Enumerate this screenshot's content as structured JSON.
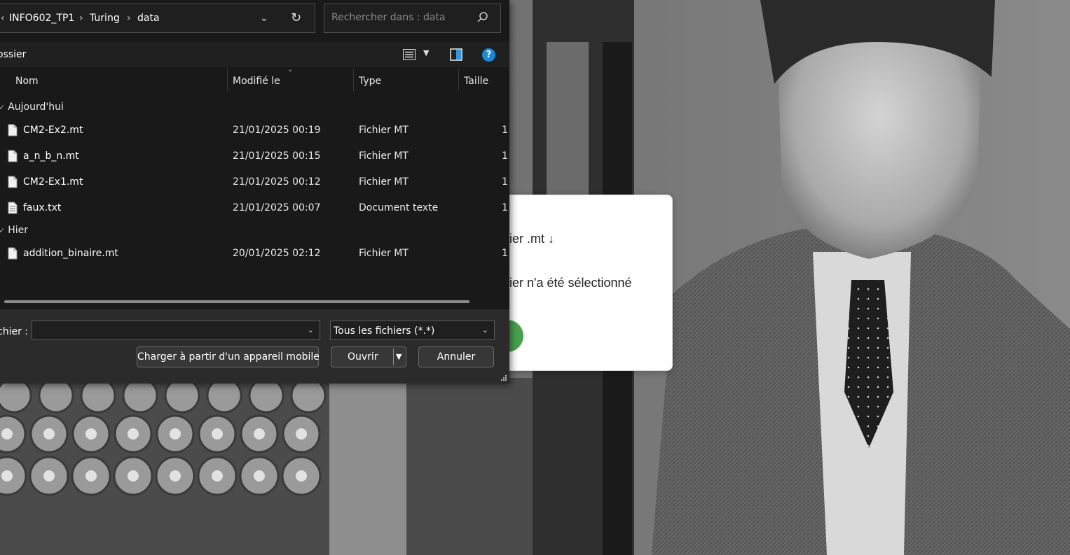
{
  "web_modal": {
    "line1": "ier .mt ↓",
    "line2": "ier n'a été sélectionné"
  },
  "dialog": {
    "breadcrumb": [
      "INFO602_TP1",
      "Turing",
      "data"
    ],
    "search_placeholder": "Rechercher dans : data",
    "toolbar_label": "ossier",
    "help_label": "?",
    "columns": {
      "name": "Nom",
      "modified": "Modifié le",
      "type": "Type",
      "size": "Taille"
    },
    "groups": [
      {
        "label": "Aujourd'hui",
        "files": [
          {
            "name": "CM2-Ex2.mt",
            "modified": "21/01/2025 00:19",
            "type": "Fichier MT",
            "size": "1",
            "icon": "file-icon"
          },
          {
            "name": "a_n_b_n.mt",
            "modified": "21/01/2025 00:15",
            "type": "Fichier MT",
            "size": "1",
            "icon": "file-icon"
          },
          {
            "name": "CM2-Ex1.mt",
            "modified": "21/01/2025 00:12",
            "type": "Fichier MT",
            "size": "1",
            "icon": "file-icon"
          },
          {
            "name": "faux.txt",
            "modified": "21/01/2025 00:07",
            "type": "Document texte",
            "size": "1",
            "icon": "text-file-icon"
          }
        ]
      },
      {
        "label": "Hier",
        "files": [
          {
            "name": "addition_binaire.mt",
            "modified": "20/01/2025 02:12",
            "type": "Fichier MT",
            "size": "1",
            "icon": "file-icon"
          }
        ]
      }
    ],
    "filename_label": "chier :",
    "filename_value": "",
    "filetype_value": "Tous les fichiers (*.*)",
    "buttons": {
      "mobile": "Charger à partir d'un appareil mobile",
      "open": "Ouvrir",
      "cancel": "Annuler"
    }
  },
  "colors": {
    "dialog_bg": "#191919",
    "accent": "#1a8ad8",
    "green": "#4aa24f"
  }
}
